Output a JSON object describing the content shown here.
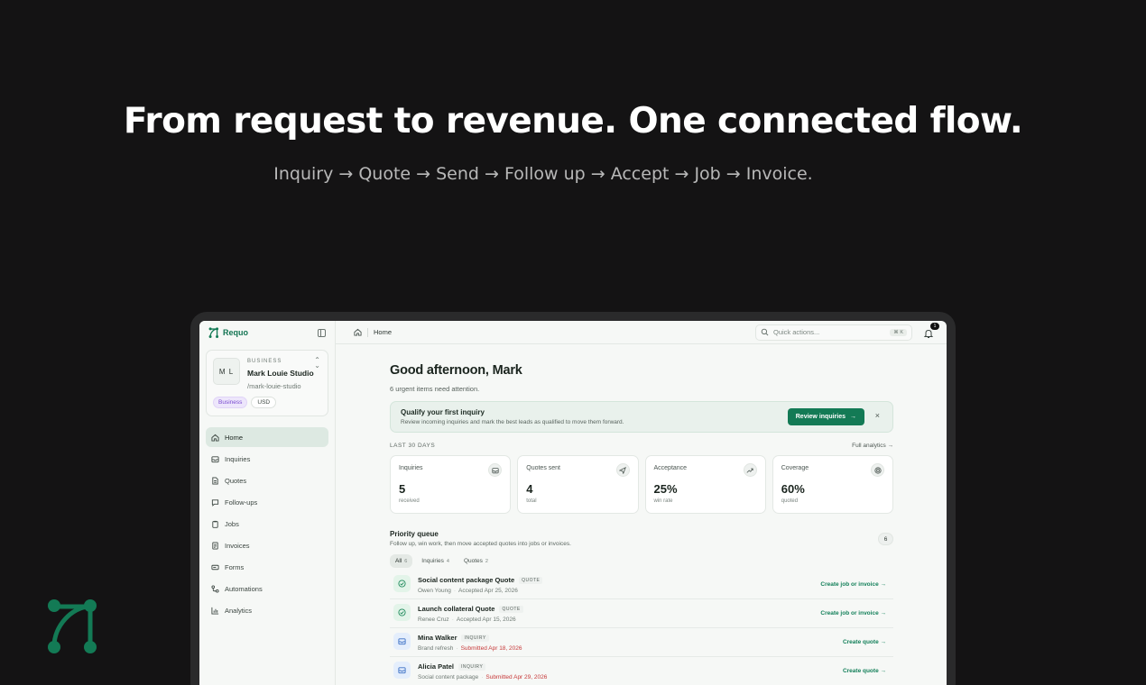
{
  "hero": {
    "title": "From request to revenue. One connected flow.",
    "subtitle": "Inquiry → Quote → Send → Follow up → Accept → Job → Invoice."
  },
  "colors": {
    "accent": "#137a55",
    "background": "#141314",
    "alert": "#c73a3a"
  },
  "app": {
    "name": "Requo",
    "business": {
      "kicker": "BUSINESS",
      "initials": "M L",
      "name": "Mark Louie Studio",
      "slug": "/mark-louie-studio",
      "plan_tag": "Business",
      "currency_tag": "USD"
    },
    "nav": [
      {
        "label": "Home",
        "icon": "home-icon"
      },
      {
        "label": "Inquiries",
        "icon": "inbox-icon"
      },
      {
        "label": "Quotes",
        "icon": "file-icon"
      },
      {
        "label": "Follow-ups",
        "icon": "message-icon"
      },
      {
        "label": "Jobs",
        "icon": "clipboard-icon"
      },
      {
        "label": "Invoices",
        "icon": "receipt-icon"
      },
      {
        "label": "Forms",
        "icon": "form-icon"
      },
      {
        "label": "Automations",
        "icon": "workflow-icon"
      },
      {
        "label": "Analytics",
        "icon": "chart-icon"
      }
    ],
    "topbar": {
      "breadcrumb": "Home",
      "search_placeholder": "Quick actions...",
      "search_shortcut": "⌘ K",
      "notification_count": "1"
    },
    "greeting": "Good afternoon, Mark",
    "urgent_text": "6 urgent items need attention.",
    "banner": {
      "title": "Qualify your first inquiry",
      "description": "Review incoming inquiries and mark the best leads as qualified to move them forward.",
      "button": "Review inquiries",
      "close": "×"
    },
    "period_label": "LAST 30 DAYS",
    "analytics_link": "Full analytics →",
    "stats": [
      {
        "label": "Inquiries",
        "value": "5",
        "sub": "received",
        "icon": "inbox-icon"
      },
      {
        "label": "Quotes sent",
        "value": "4",
        "sub": "total",
        "icon": "send-icon"
      },
      {
        "label": "Acceptance",
        "value": "25%",
        "sub": "win rate",
        "icon": "trend-up-icon"
      },
      {
        "label": "Coverage",
        "value": "60%",
        "sub": "quoted",
        "icon": "target-icon"
      }
    ],
    "priority_queue": {
      "title": "Priority queue",
      "description": "Follow up, win work, then move accepted quotes into jobs or invoices.",
      "count": "6",
      "tabs": [
        {
          "label": "All",
          "count": "6"
        },
        {
          "label": "Inquiries",
          "count": "4"
        },
        {
          "label": "Quotes",
          "count": "2"
        }
      ],
      "rows": [
        {
          "title": "Social content package Quote",
          "badge": "QUOTE",
          "person": "Owen Young",
          "status": "Accepted Apr 25, 2026",
          "action": "Create job or invoice →",
          "kind": "ok"
        },
        {
          "title": "Launch collateral Quote",
          "badge": "QUOTE",
          "person": "Renee Cruz",
          "status": "Accepted Apr 15, 2026",
          "action": "Create job or invoice →",
          "kind": "ok"
        },
        {
          "title": "Mina Walker",
          "badge": "INQUIRY",
          "person": "Brand refresh",
          "status": "Submitted Apr 18, 2026",
          "action": "Create quote →",
          "kind": "mail"
        },
        {
          "title": "Alicia Patel",
          "badge": "INQUIRY",
          "person": "Social content package",
          "status": "Submitted Apr 29, 2026",
          "action": "Create quote →",
          "kind": "mail"
        }
      ]
    }
  }
}
